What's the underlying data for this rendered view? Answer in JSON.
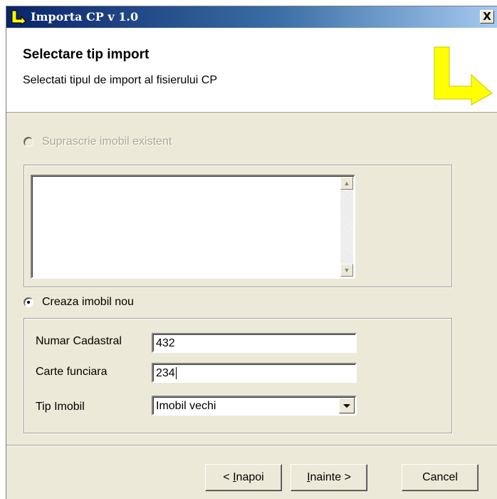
{
  "window": {
    "title": "Importa CP v 1.0",
    "close_label": "X"
  },
  "header": {
    "title": "Selectare tip import",
    "subtitle": "Selectati tipul de import al fisierului CP"
  },
  "options": {
    "overwrite_label": "Suprascrie imobil existent",
    "create_label": "Creaza imobil nou"
  },
  "form": {
    "cadastral_label": "Numar Cadastral",
    "cadastral_value": "432",
    "carte_label": "Carte funciara",
    "carte_value": "234",
    "tip_label": "Tip Imobil",
    "tip_value": "Imobil vechi"
  },
  "buttons": {
    "back_lead": "< ",
    "back_mnemonic": "I",
    "back_rest": "napoi",
    "next_mnemonic": "I",
    "next_rest": "nainte >",
    "cancel_label": "Cancel"
  },
  "colors": {
    "logo_yellow": "#ffff00",
    "title_bar": "#0a246a",
    "dialog_face": "#ece9d8"
  }
}
